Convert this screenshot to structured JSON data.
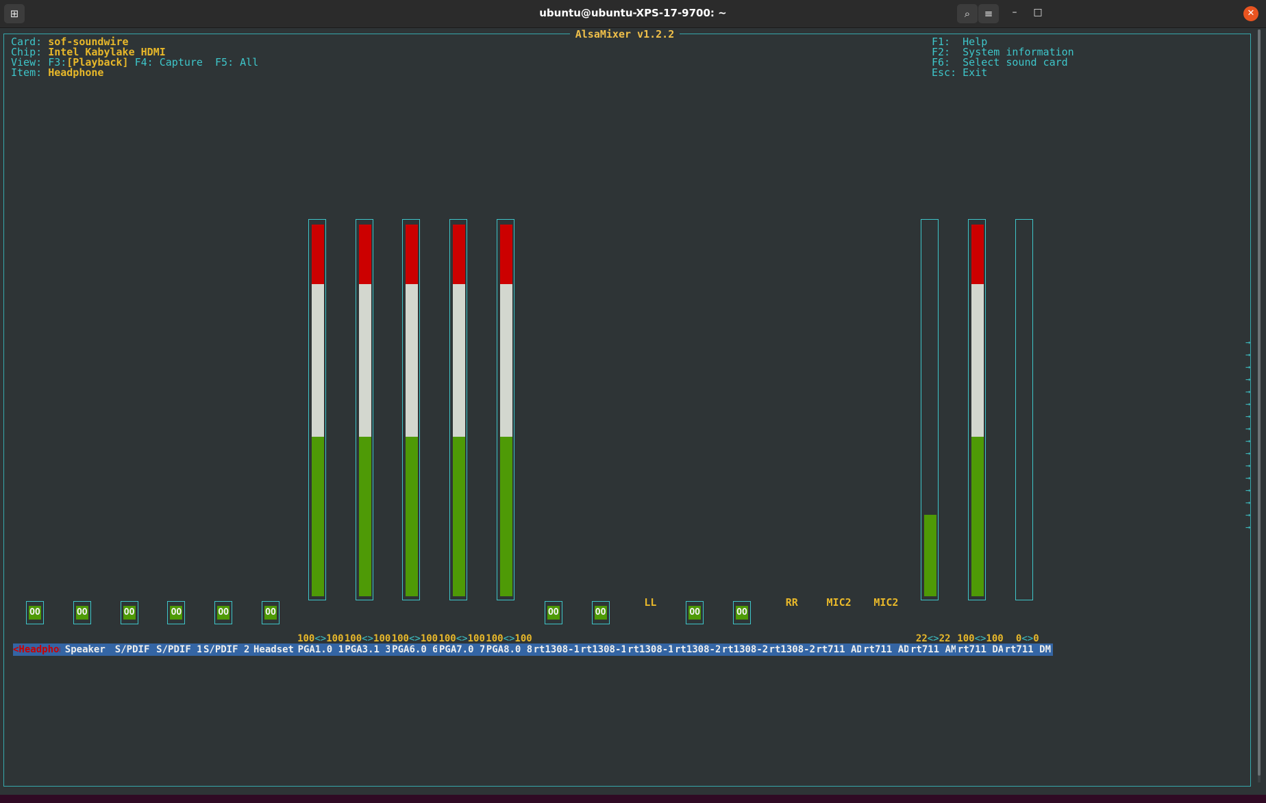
{
  "window": {
    "title": "ubuntu@ubuntu-XPS-17-9700: ~",
    "new_tab_icon": "new-tab-icon",
    "buttons": {
      "search": "search-icon",
      "menu": "hamburger-menu-icon",
      "minimize": "–",
      "maximize": "□",
      "close": "✕"
    }
  },
  "mixer": {
    "title": "AlsaMixer v1.2.2",
    "card_label": "Card:",
    "card_value": "sof-soundwire",
    "chip_label": "Chip:",
    "chip_value": "Intel Kabylake HDMI",
    "view_label": "View:",
    "view_f3": "F3:",
    "view_playback": "[Playback]",
    "view_f4": "F4: Capture",
    "view_f5": "F5: All",
    "item_label": "Item:",
    "item_value": "Headphone",
    "help": [
      {
        "key": "F1:",
        "text": "Help"
      },
      {
        "key": "F2:",
        "text": "System information"
      },
      {
        "key": "F6:",
        "text": "Select sound card"
      },
      {
        "key": "Esc:",
        "text": "Exit"
      }
    ]
  },
  "channels": [
    {
      "label": "<Headphone>",
      "mute": "OO",
      "selected": true
    },
    {
      "label": "Speaker",
      "mute": "OO"
    },
    {
      "label": "S/PDIF",
      "mute": "OO"
    },
    {
      "label": "S/PDIF 1",
      "mute": "OO"
    },
    {
      "label": "S/PDIF 2",
      "mute": "OO"
    },
    {
      "label": "Headset",
      "mute": "OO"
    },
    {
      "label": "PGA1.0 1",
      "value_l": "100",
      "value_r": "100",
      "sep": "<>",
      "level": 1.0
    },
    {
      "label": "PGA3.1 3",
      "value_l": "100",
      "value_r": "100",
      "sep": "<>",
      "level": 1.0
    },
    {
      "label": "PGA6.0 6",
      "value_l": "100",
      "value_r": "100",
      "sep": "<>",
      "level": 1.0
    },
    {
      "label": "PGA7.0 7",
      "value_l": "100",
      "value_r": "100",
      "sep": "<>",
      "level": 1.0
    },
    {
      "label": "PGA8.0 8",
      "value_l": "100",
      "value_r": "100",
      "sep": "<>",
      "level": 1.0
    },
    {
      "label": "rt1308-1",
      "mute": "OO"
    },
    {
      "label": "rt1308-1",
      "mute": "OO"
    },
    {
      "label": "rt1308-1",
      "tag": "LL"
    },
    {
      "label": "rt1308-2",
      "mute": "OO"
    },
    {
      "label": "rt1308-2",
      "mute": "OO"
    },
    {
      "label": "rt1308-2",
      "tag": "RR"
    },
    {
      "label": "rt711 AD",
      "tag": "MIC2"
    },
    {
      "label": "rt711 AD",
      "tag": "MIC2"
    },
    {
      "label": "rt711 AM",
      "value_l": "22",
      "value_r": "22",
      "sep": "<>",
      "level": 0.22
    },
    {
      "label": "rt711 DA",
      "value_l": "100",
      "value_r": "100",
      "sep": "<>",
      "level": 1.0
    },
    {
      "label": "rt711 DM",
      "value_l": "0",
      "value_r": "0",
      "sep": "<>",
      "level": 0
    }
  ],
  "colors": {
    "meter_red": "#cc0000",
    "meter_white": "#d3d7cf",
    "meter_green": "#4e9a06",
    "accent": "#3ec6ca",
    "value": "#e8b82a"
  },
  "arrow_glyph": "→",
  "arrow_count": 16
}
